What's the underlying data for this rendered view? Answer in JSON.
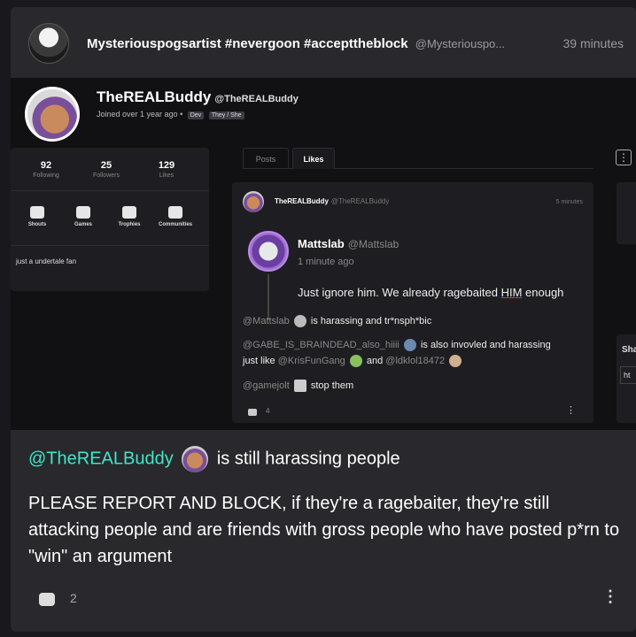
{
  "post": {
    "author": "Mysteriouspogsartist #nevergoon #accepttheblock",
    "handle": "@Mysteriouspo...",
    "time": "39 minutes"
  },
  "screenshot": {
    "profile": {
      "name": "TheREALBuddy",
      "handle": "@TheREALBuddy",
      "joined": "Joined over 1 year ago",
      "tags": [
        "Dev",
        "They / She"
      ]
    },
    "stats": [
      {
        "value": "92",
        "label": "Following"
      },
      {
        "value": "25",
        "label": "Followers"
      },
      {
        "value": "129",
        "label": "Likes"
      }
    ],
    "nav": [
      "Shouts",
      "Games",
      "Trophies",
      "Communities"
    ],
    "bio": "just a undertale fan",
    "tabs": {
      "posts": "Posts",
      "likes": "Likes"
    },
    "inner_post": {
      "author": "TheREALBuddy",
      "handle": "@TheREALBuddy",
      "time": "5 minutes",
      "quote": {
        "name": "Mattslab",
        "handle": "@Mattslab",
        "time": "1 minute ago",
        "text_before": "Just ignore him. We already ragebaited ",
        "text_highlight": "HIM",
        "text_after": " enough"
      },
      "line1_mention": "@Mattslab",
      "line1_text": "is harassing and tr*nsph*bic",
      "line2_mention": "@GABE_IS_BRAINDEAD_also_hiiii",
      "line2_text": "is also invovled and harassing",
      "line3_prefix": "just like",
      "line3_mention1": "@KrisFunGang",
      "line3_and": "and",
      "line3_mention2": "@ldklol18472",
      "line4_mention": "@gamejolt",
      "line4_text": "stop them",
      "comment_count": "4"
    },
    "side_label": "Sha",
    "side_input": "ht"
  },
  "body": {
    "mention": "@TheREALBuddy",
    "mention_suffix": "is still harassing people",
    "text": "PLEASE REPORT AND BLOCK, if they're a ragebaiter, they're still attacking people and are friends with gross people who have posted p*rn to \"win\" an argument"
  },
  "footer": {
    "comment_count": "2"
  },
  "icons": {
    "menu": "⋮",
    "more": "⋮"
  }
}
